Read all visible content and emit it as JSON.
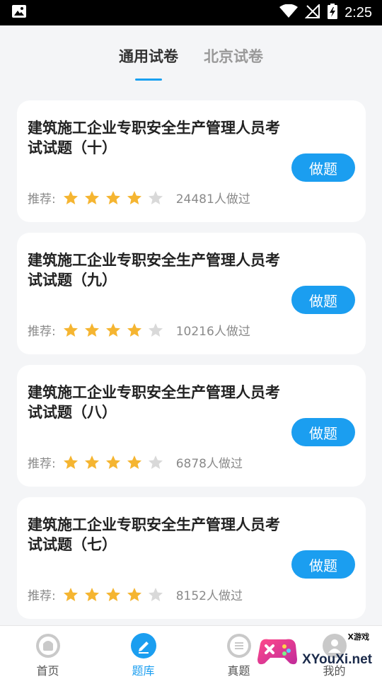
{
  "status_bar": {
    "time": "2:25",
    "icons": [
      "image-icon",
      "wifi-icon",
      "no-signal-icon",
      "battery-charging-icon"
    ]
  },
  "tabs": [
    {
      "label": "通用试卷",
      "active": true
    },
    {
      "label": "北京试卷",
      "active": false
    }
  ],
  "cards": [
    {
      "title": "建筑施工企业专职安全生产管理人员考试试题（十）",
      "recommend_label": "推荐:",
      "rating": 4,
      "max_rating": 5,
      "count_text": "24481人做过",
      "button": "做题"
    },
    {
      "title": "建筑施工企业专职安全生产管理人员考试试题（九）",
      "recommend_label": "推荐:",
      "rating": 4,
      "max_rating": 5,
      "count_text": "10216人做过",
      "button": "做题"
    },
    {
      "title": "建筑施工企业专职安全生产管理人员考试试题（八）",
      "recommend_label": "推荐:",
      "rating": 4,
      "max_rating": 5,
      "count_text": "6878人做过",
      "button": "做题"
    },
    {
      "title": "建筑施工企业专职安全生产管理人员考试试题（七）",
      "recommend_label": "推荐:",
      "rating": 4,
      "max_rating": 5,
      "count_text": "8152人做过",
      "button": "做题"
    }
  ],
  "bottom_nav": [
    {
      "label": "首页",
      "icon": "home-icon",
      "active": false
    },
    {
      "label": "题库",
      "icon": "edit-icon",
      "active": true
    },
    {
      "label": "真题",
      "icon": "list-icon",
      "active": false
    },
    {
      "label": "我的",
      "icon": "user-icon",
      "active": false
    }
  ],
  "watermark": {
    "small": "X游戏",
    "text": "XYouXi.net"
  },
  "colors": {
    "accent": "#1b9ef0",
    "star_on": "#f5b531",
    "star_off": "#d9d9d9",
    "background": "#f4f5f7"
  }
}
